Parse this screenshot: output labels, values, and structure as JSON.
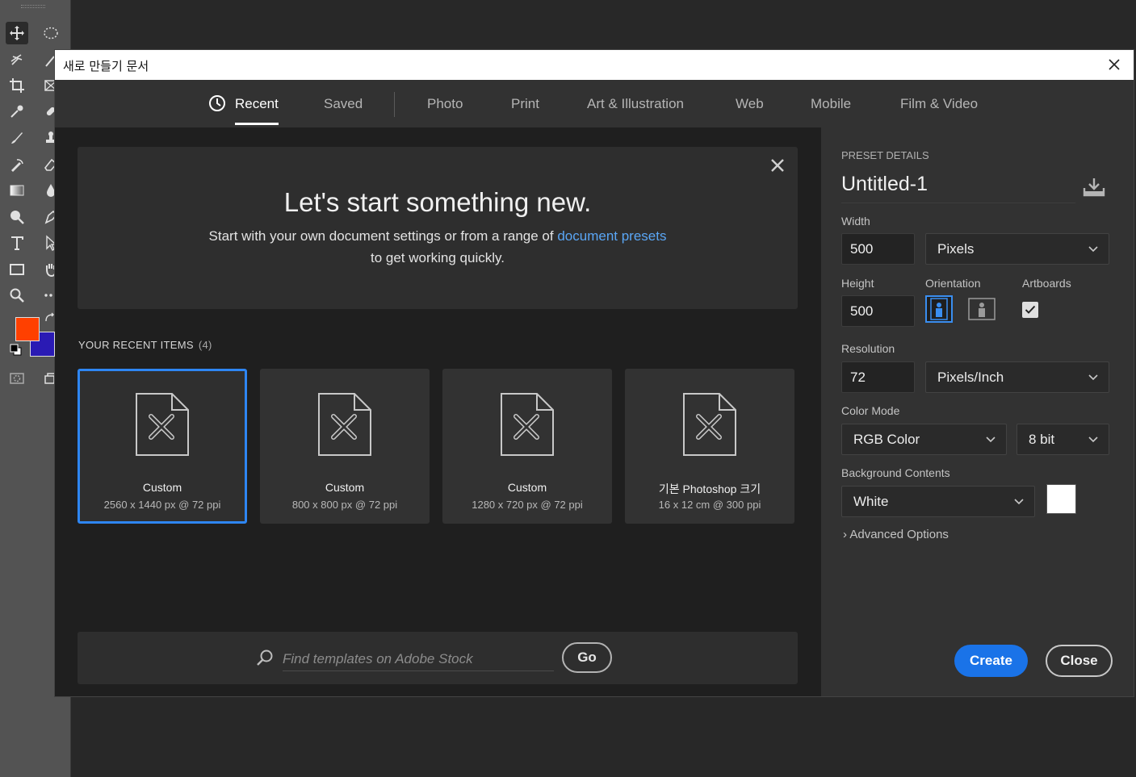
{
  "dialog": {
    "title": "새로 만들기 문서"
  },
  "tabs": [
    {
      "label": "Recent",
      "active": true
    },
    {
      "label": "Saved"
    },
    {
      "label": "Photo"
    },
    {
      "label": "Print"
    },
    {
      "label": "Art & Illustration"
    },
    {
      "label": "Web"
    },
    {
      "label": "Mobile"
    },
    {
      "label": "Film & Video"
    }
  ],
  "banner": {
    "heading": "Let's start something new.",
    "line1_prefix": "Start with your own document settings or from a range of",
    "line1_link": "document presets",
    "line2": "to get working quickly."
  },
  "recent": {
    "heading": "YOUR RECENT ITEMS",
    "count": "(4)",
    "items": [
      {
        "name": "Custom",
        "dims": "2560 x 1440 px @ 72 ppi",
        "selected": true
      },
      {
        "name": "Custom",
        "dims": "800 x 800 px @ 72 ppi"
      },
      {
        "name": "Custom",
        "dims": "1280 x 720 px @ 72 ppi"
      },
      {
        "name": "기본 Photoshop 크기",
        "dims": "16 x 12 cm @ 300 ppi"
      }
    ]
  },
  "search": {
    "placeholder": "Find templates on Adobe Stock",
    "go_label": "Go"
  },
  "preset": {
    "section_label": "PRESET DETAILS",
    "name": "Untitled-1",
    "width_label": "Width",
    "width_value": "500",
    "width_unit": "Pixels",
    "height_label": "Height",
    "height_value": "500",
    "orientation_label": "Orientation",
    "orientation": "portrait",
    "artboards_label": "Artboards",
    "artboards_checked": true,
    "resolution_label": "Resolution",
    "resolution_value": "72",
    "resolution_unit": "Pixels/Inch",
    "color_mode_label": "Color Mode",
    "color_mode": "RGB Color",
    "bit_depth": "8 bit",
    "background_label": "Background Contents",
    "background": "White",
    "background_swatch": "#ffffff",
    "advanced_label": "Advanced Options",
    "create_label": "Create",
    "close_label": "Close"
  },
  "colors": {
    "accent": "#1a73e8",
    "link": "#5aa6f5",
    "foreground_swatch": "#ff4000",
    "background_swatch": "#2a1ab4"
  }
}
